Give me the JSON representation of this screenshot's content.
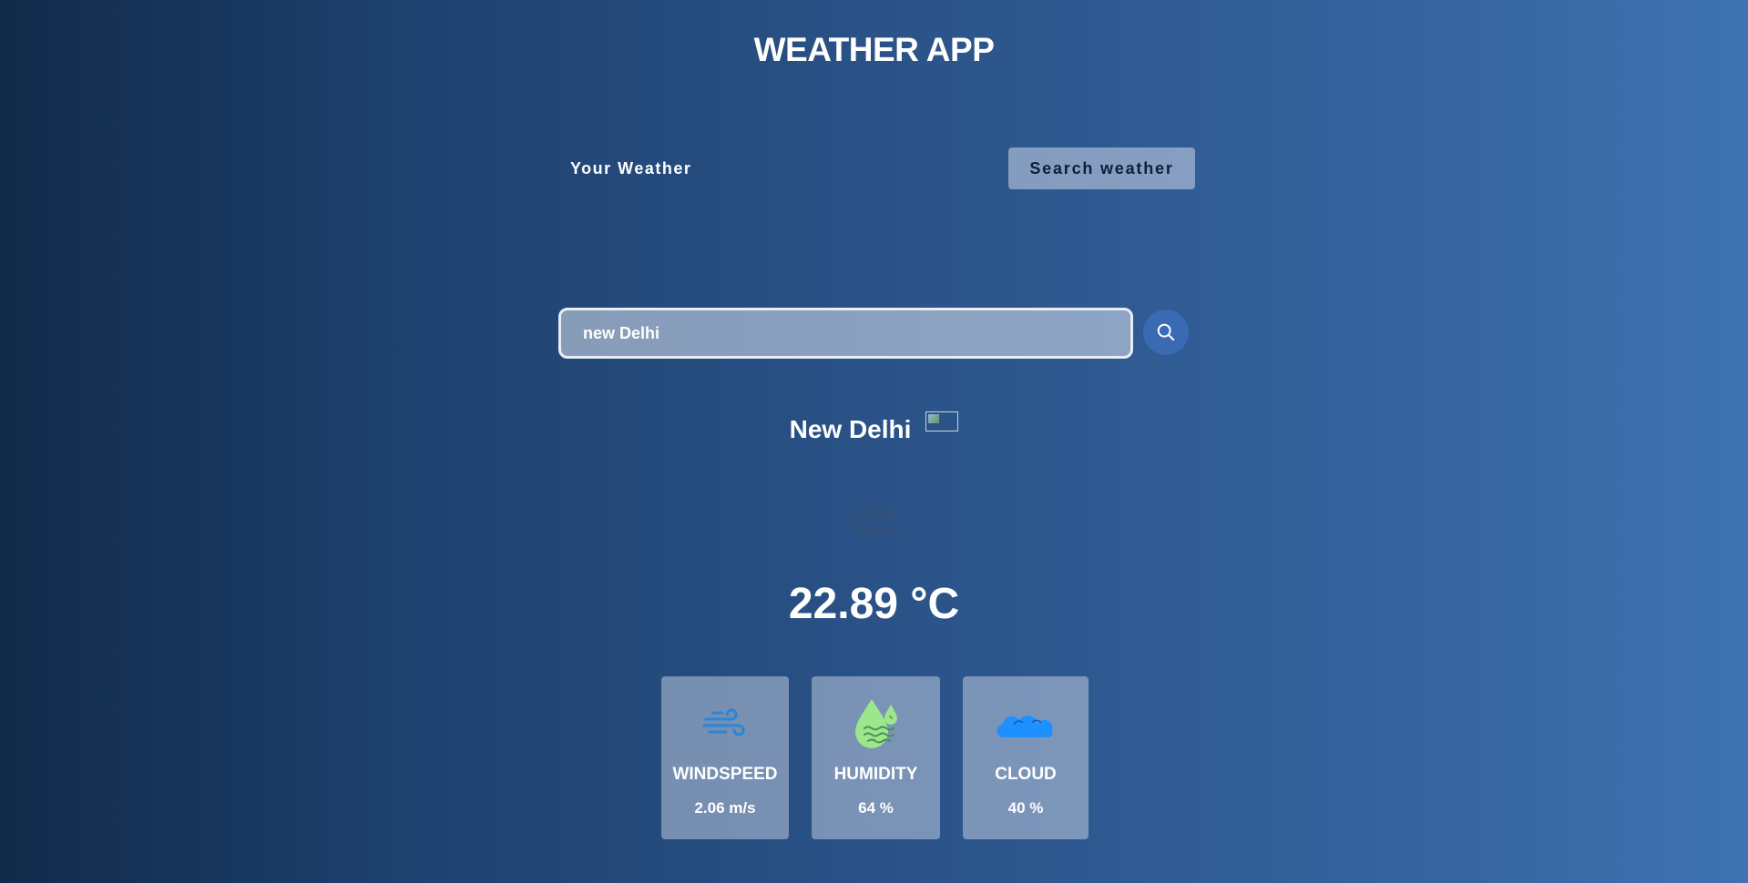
{
  "header": {
    "title": "WEATHER APP"
  },
  "tabs": {
    "your_weather": "Your Weather",
    "search_weather": "Search weather"
  },
  "search": {
    "value": "new Delhi",
    "icon": "search-icon"
  },
  "weather": {
    "city": "New Delhi",
    "flag_icon": "country-flag-image",
    "condition_icon": "wind-haze-icon",
    "temperature": "22.89 °C"
  },
  "stats": [
    {
      "label": "WINDSPEED",
      "value": "2.06 m/s",
      "icon": "wind-icon",
      "color": "#2b86d6"
    },
    {
      "label": "HUMIDITY",
      "value": "64 %",
      "icon": "humidity-drop-icon",
      "color": "#9be78a"
    },
    {
      "label": "CLOUD",
      "value": "40 %",
      "icon": "cloud-icon",
      "color": "#1e90ff"
    }
  ],
  "colors": {
    "search_button": "#3a6ab3",
    "card_background": "rgba(219,226,239,0.45)"
  }
}
